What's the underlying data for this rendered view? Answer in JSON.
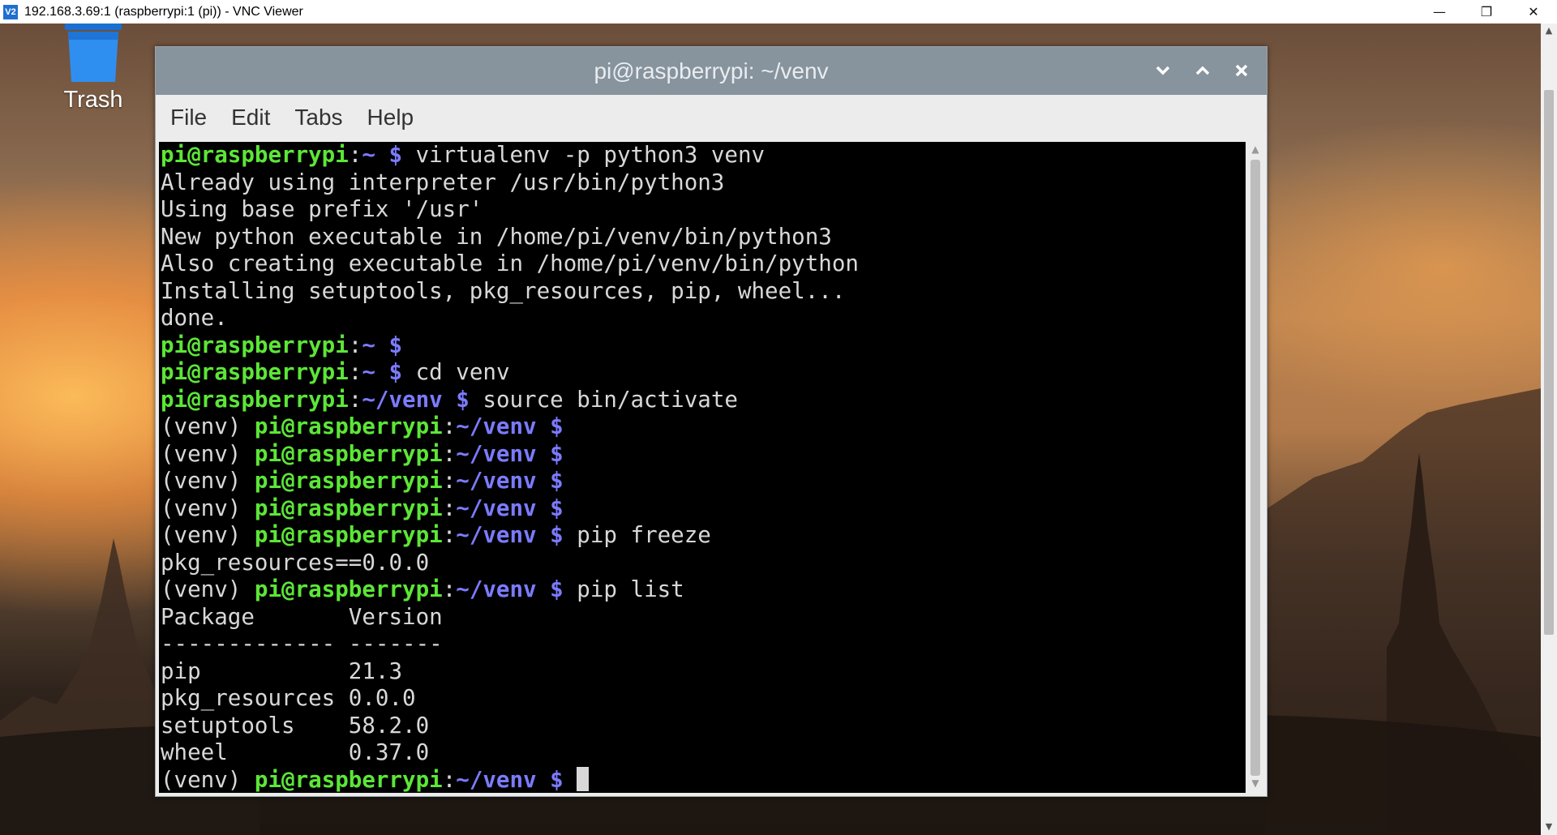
{
  "vnc": {
    "title": "192.168.3.69:1 (raspberrypi:1 (pi)) - VNC Viewer",
    "app_icon_text": "V2",
    "controls": {
      "minimize": "—",
      "restore": "❐",
      "close": "✕"
    }
  },
  "desktop": {
    "trash_label": "Trash"
  },
  "terminal": {
    "title": "pi@raspberrypi: ~/venv",
    "menu": [
      "File",
      "Edit",
      "Tabs",
      "Help"
    ],
    "lines": [
      {
        "venv": "",
        "user": "pi@raspberrypi",
        "sep": ":",
        "path": "~",
        "prompt": " $",
        "cmd": " virtualenv -p python3 venv",
        "out": ""
      },
      {
        "out": "Already using interpreter /usr/bin/python3"
      },
      {
        "out": "Using base prefix '/usr'"
      },
      {
        "out": "New python executable in /home/pi/venv/bin/python3"
      },
      {
        "out": "Also creating executable in /home/pi/venv/bin/python"
      },
      {
        "out": "Installing setuptools, pkg_resources, pip, wheel..."
      },
      {
        "out": "done."
      },
      {
        "venv": "",
        "user": "pi@raspberrypi",
        "sep": ":",
        "path": "~",
        "prompt": " $",
        "cmd": ""
      },
      {
        "venv": "",
        "user": "pi@raspberrypi",
        "sep": ":",
        "path": "~",
        "prompt": " $",
        "cmd": " cd venv"
      },
      {
        "venv": "",
        "user": "pi@raspberrypi",
        "sep": ":",
        "path": "~/venv",
        "prompt": " $",
        "cmd": " source bin/activate"
      },
      {
        "venv": "(venv) ",
        "user": "pi@raspberrypi",
        "sep": ":",
        "path": "~/venv",
        "prompt": " $",
        "cmd": ""
      },
      {
        "venv": "(venv) ",
        "user": "pi@raspberrypi",
        "sep": ":",
        "path": "~/venv",
        "prompt": " $",
        "cmd": ""
      },
      {
        "venv": "(venv) ",
        "user": "pi@raspberrypi",
        "sep": ":",
        "path": "~/venv",
        "prompt": " $",
        "cmd": ""
      },
      {
        "venv": "(venv) ",
        "user": "pi@raspberrypi",
        "sep": ":",
        "path": "~/venv",
        "prompt": " $",
        "cmd": ""
      },
      {
        "venv": "(venv) ",
        "user": "pi@raspberrypi",
        "sep": ":",
        "path": "~/venv",
        "prompt": " $",
        "cmd": " pip freeze"
      },
      {
        "out": "pkg_resources==0.0.0"
      },
      {
        "venv": "(venv) ",
        "user": "pi@raspberrypi",
        "sep": ":",
        "path": "~/venv",
        "prompt": " $",
        "cmd": " pip list"
      },
      {
        "out": "Package       Version"
      },
      {
        "out": "------------- -------"
      },
      {
        "out": "pip           21.3"
      },
      {
        "out": "pkg_resources 0.0.0"
      },
      {
        "out": "setuptools    58.2.0"
      },
      {
        "out": "wheel         0.37.0"
      },
      {
        "venv": "(venv) ",
        "user": "pi@raspberrypi",
        "sep": ":",
        "path": "~/venv",
        "prompt": " $",
        "cmd": " ",
        "cursor": true
      }
    ]
  }
}
